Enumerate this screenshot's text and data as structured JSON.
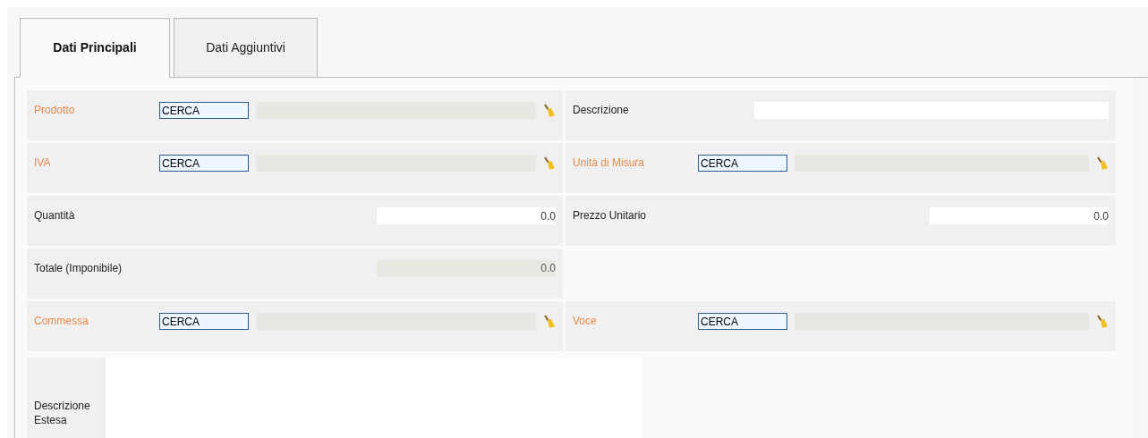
{
  "tabs": [
    {
      "label": "Dati Principali",
      "selected": true
    },
    {
      "label": "Dati Aggiuntivi",
      "selected": false
    }
  ],
  "rows": [
    [
      {
        "kind": "lookup",
        "label": "Prodotto",
        "required": true,
        "value": "CERCA"
      },
      {
        "kind": "text",
        "label": "Descrizione",
        "required": false
      }
    ],
    [
      {
        "kind": "lookup",
        "label": "IVA",
        "required": true,
        "value": "CERCA"
      },
      {
        "kind": "lookup",
        "label": "Unità di Misura",
        "required": true,
        "value": "CERCA"
      }
    ],
    [
      {
        "kind": "number",
        "label": "Quantità",
        "required": false,
        "value": "0.0"
      },
      {
        "kind": "number",
        "label": "Prezzo Unitario",
        "required": false,
        "value": "0.0"
      }
    ],
    [
      {
        "kind": "readonly",
        "label": "Totale (Imponibile)",
        "required": false,
        "value": "0.0"
      }
    ],
    [
      {
        "kind": "lookup",
        "label": "Commessa",
        "required": true,
        "value": "CERCA"
      },
      {
        "kind": "lookup",
        "label": "Voce",
        "required": true,
        "value": "CERCA"
      }
    ]
  ],
  "extended": {
    "label": "Descrizione Estesa"
  }
}
